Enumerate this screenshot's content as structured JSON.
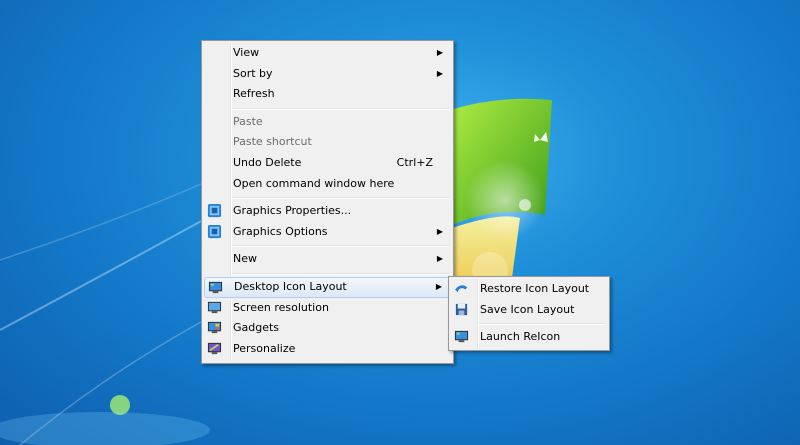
{
  "context_menu": {
    "items": [
      {
        "label": "View",
        "submenu": true
      },
      {
        "label": "Sort by",
        "submenu": true
      },
      {
        "label": "Refresh"
      },
      {
        "label": "Paste",
        "disabled": true
      },
      {
        "label": "Paste shortcut",
        "disabled": true
      },
      {
        "label": "Undo Delete",
        "shortcut": "Ctrl+Z"
      },
      {
        "label": "Open command window here"
      },
      {
        "label": "Graphics Properties...",
        "icon": "graphics-icon"
      },
      {
        "label": "Graphics Options",
        "icon": "graphics-icon",
        "submenu": true
      },
      {
        "label": "New",
        "submenu": true
      },
      {
        "label": "Desktop Icon Layout",
        "icon": "monitor-icon",
        "submenu": true,
        "highlighted": true
      },
      {
        "label": "Screen resolution",
        "icon": "screen-resolution-icon"
      },
      {
        "label": "Gadgets",
        "icon": "gadgets-icon"
      },
      {
        "label": "Personalize",
        "icon": "personalize-icon"
      }
    ]
  },
  "submenu": {
    "items": [
      {
        "label": "Restore Icon Layout",
        "icon": "restore-icon"
      },
      {
        "label": "Save Icon Layout",
        "icon": "save-icon"
      },
      {
        "label": "Launch ReIcon",
        "icon": "monitor-icon"
      }
    ]
  },
  "colors": {
    "desktop": "#1479c9",
    "menu_bg": "#f0f0f0",
    "highlight_border": "#aecff7",
    "disabled_text": "#6d6d6d"
  }
}
